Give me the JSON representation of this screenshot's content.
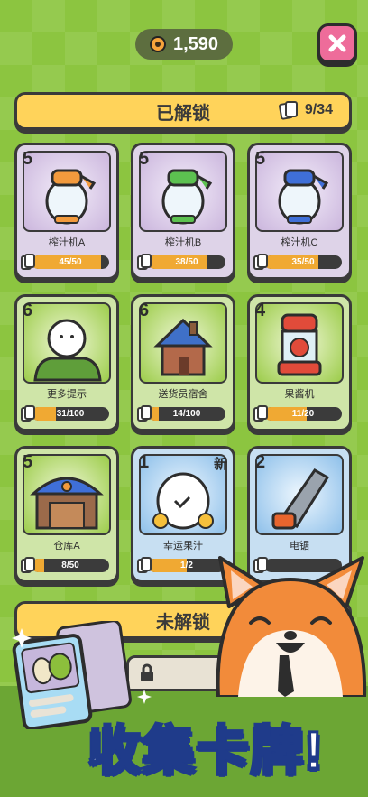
{
  "header": {
    "coins": "1,590",
    "close_icon": "close-icon"
  },
  "unlocked": {
    "title": "已解锁",
    "count": "9/34"
  },
  "locked": {
    "title": "未解锁"
  },
  "promo": {
    "text": "收集卡牌!"
  },
  "colors": {
    "accent_yellow": "#ffd35a",
    "progress": "#f0a933",
    "close_pink": "#ee6c9a"
  },
  "cards": [
    {
      "level": "5",
      "name": "榨汁机A",
      "progress": "45/50",
      "fill": 0.9,
      "theme": "purple",
      "icon": "juicer-orange-icon",
      "new": ""
    },
    {
      "level": "5",
      "name": "榨汁机B",
      "progress": "38/50",
      "fill": 0.76,
      "theme": "purple",
      "icon": "juicer-green-icon",
      "new": ""
    },
    {
      "level": "5",
      "name": "榨汁机C",
      "progress": "35/50",
      "fill": 0.7,
      "theme": "purple",
      "icon": "juicer-blue-icon",
      "new": ""
    },
    {
      "level": "6",
      "name": "更多提示",
      "progress": "31/100",
      "fill": 0.31,
      "theme": "green",
      "icon": "hint-ghost-icon",
      "new": ""
    },
    {
      "level": "6",
      "name": "送货员宿舍",
      "progress": "14/100",
      "fill": 0.14,
      "theme": "green",
      "icon": "house-icon",
      "new": ""
    },
    {
      "level": "4",
      "name": "果酱机",
      "progress": "11/20",
      "fill": 0.55,
      "theme": "green",
      "icon": "jam-machine-icon",
      "new": ""
    },
    {
      "level": "5",
      "name": "仓库A",
      "progress": "8/50",
      "fill": 0.16,
      "theme": "green",
      "icon": "warehouse-icon",
      "new": ""
    },
    {
      "level": "1",
      "name": "幸运果汁",
      "progress": "1/2",
      "fill": 0.5,
      "theme": "blue",
      "icon": "lucky-juice-icon",
      "new": "新"
    },
    {
      "level": "2",
      "name": "电锯",
      "progress": "",
      "fill": 0,
      "theme": "blue",
      "icon": "chainsaw-icon",
      "new": ""
    }
  ]
}
